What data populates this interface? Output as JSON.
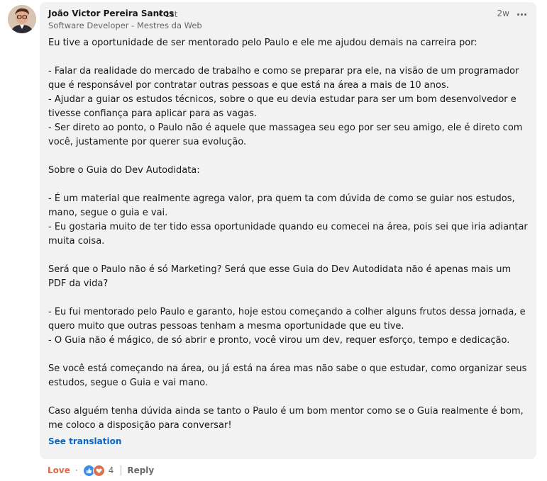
{
  "comment": {
    "author": "João Victor Pereira Santos",
    "degree": "• 1st",
    "headline": "Software Developer - Mestres da Web",
    "time": "2w",
    "paragraphs": [
      "Eu tive a oportunidade de ser mentorado pelo Paulo e ele me ajudou demais na carreira por:",
      "",
      "- Falar da realidade do mercado de trabalho e como se preparar pra ele, na visão de um programador que é responsável por contratar outras pessoas e que está na área a mais de 10 anos.",
      "- Ajudar a guiar os estudos técnicos, sobre o que eu devia estudar para ser um bom desenvolvedor e tivesse confiança para aplicar para as vagas.",
      "- Ser direto ao ponto, o Paulo não é aquele que massagea seu ego por ser seu amigo, ele é direto com você, justamente por querer sua evolução.",
      "",
      "Sobre o Guia do Dev Autodidata:",
      "",
      "- É um material que realmente agrega valor, pra quem ta com dúvida de como se guiar nos estudos, mano, segue o guia e vai.",
      "- Eu gostaria muito de ter tido essa oportunidade quando eu comecei na área, pois sei que iria adiantar muita coisa.",
      "",
      "Será que o Paulo não é só Marketing? Será que esse Guia do Dev Autodidata não é apenas mais um PDF da vida?",
      "",
      "- Eu fui mentorado pelo Paulo e garanto, hoje estou começando a colher alguns frutos dessa jornada, e quero muito que outras pessoas tenham a mesma oportunidade que eu tive.",
      "- O Guia não é mágico, de só abrir e pronto, você virou um dev, requer esforço, tempo e dedicação.",
      "",
      "Se você está começando na área, ou já está na área mas não sabe o que estudar, como organizar seus estudos, segue o Guia e vai mano.",
      "",
      "Caso alguém tenha dúvida ainda se tanto o Paulo é um bom mentor como se o Guia realmente é bom, me coloco a disposição para conversar!"
    ],
    "see_translation": "See translation"
  },
  "actions": {
    "love_label": "Love",
    "separator": "·",
    "reaction_count": "4",
    "reply_label": "Reply"
  },
  "colors": {
    "bubble_bg": "#f2f2f2",
    "link_blue": "#0a66c2",
    "love_orange": "#e06847",
    "like_blue": "#378fe9"
  },
  "icons": [
    "avatar",
    "more-options-icon",
    "like-reaction-icon",
    "love-reaction-icon"
  ]
}
